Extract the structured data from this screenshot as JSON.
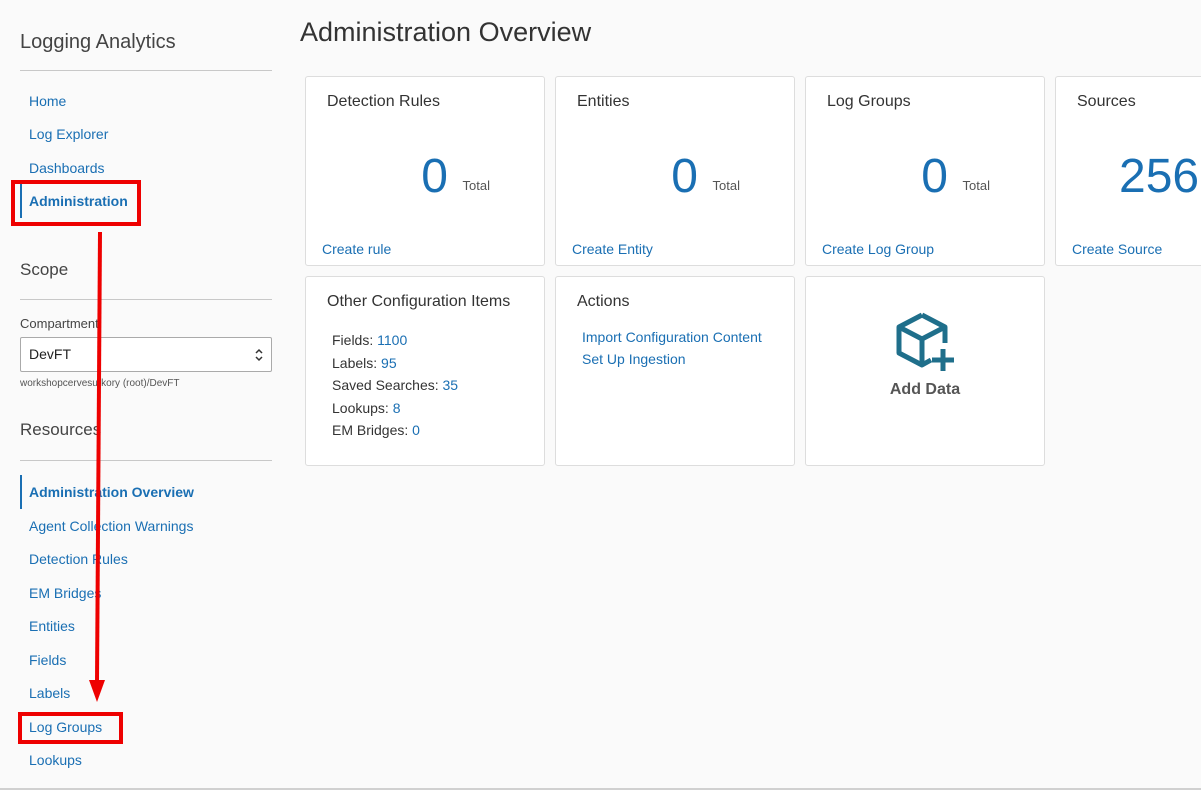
{
  "sidebar": {
    "app_title": "Logging Analytics",
    "nav": [
      {
        "label": "Home"
      },
      {
        "label": "Log Explorer"
      },
      {
        "label": "Dashboards"
      },
      {
        "label": "Administration",
        "active": true
      }
    ],
    "scope": {
      "title": "Scope",
      "compartment_label": "Compartment",
      "compartment_value": "DevFT",
      "compartment_path": "workshopcervesurkory (root)/DevFT"
    },
    "resources": {
      "title": "Resources",
      "items": [
        {
          "label": "Administration Overview",
          "active": true
        },
        {
          "label": "Agent Collection Warnings"
        },
        {
          "label": "Detection Rules"
        },
        {
          "label": "EM Bridges"
        },
        {
          "label": "Entities"
        },
        {
          "label": "Fields"
        },
        {
          "label": "Labels"
        },
        {
          "label": "Log Groups"
        },
        {
          "label": "Lookups"
        }
      ]
    }
  },
  "main": {
    "title": "Administration Overview",
    "cards": [
      {
        "title": "Detection Rules",
        "value": "0",
        "unit": "Total",
        "link": "Create rule"
      },
      {
        "title": "Entities",
        "value": "0",
        "unit": "Total",
        "link": "Create Entity"
      },
      {
        "title": "Log Groups",
        "value": "0",
        "unit": "Total",
        "link": "Create Log Group"
      },
      {
        "title": "Sources",
        "value": "256",
        "unit": "",
        "link": "Create Source"
      }
    ],
    "other_config": {
      "title": "Other Configuration Items",
      "items": [
        {
          "label": "Fields:",
          "value": "1100"
        },
        {
          "label": "Labels:",
          "value": "95"
        },
        {
          "label": "Saved Searches:",
          "value": "35"
        },
        {
          "label": "Lookups:",
          "value": "8"
        },
        {
          "label": "EM Bridges:",
          "value": "0"
        }
      ]
    },
    "actions": {
      "title": "Actions",
      "items": [
        {
          "label": "Import Configuration Content"
        },
        {
          "label": "Set Up Ingestion"
        }
      ]
    },
    "add_data": {
      "label": "Add Data",
      "icon": "cube-plus-icon"
    }
  },
  "colors": {
    "link": "#1a6fb3",
    "annotation": "#ee0000",
    "icon": "#1f6f8b"
  }
}
